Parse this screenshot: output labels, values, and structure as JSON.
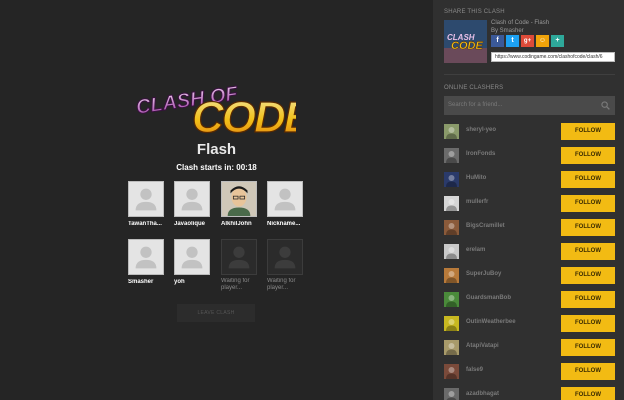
{
  "clash": {
    "logo_line1": "CLASH OF",
    "logo_line2": "CODE",
    "title": "Flash",
    "starts_label": "Clash starts in: 00:18",
    "leave_label": "LEAVE CLASH"
  },
  "players": [
    {
      "name": "TawanTha...",
      "state": "joined",
      "avatar": "default"
    },
    {
      "name": "Javaolique",
      "state": "joined",
      "avatar": "default"
    },
    {
      "name": "AlkhilJohn",
      "state": "joined",
      "avatar": "photo"
    },
    {
      "name": "Nickname...",
      "state": "joined",
      "avatar": "default"
    },
    {
      "name": "Smasher",
      "state": "joined",
      "avatar": "default"
    },
    {
      "name": "yoh",
      "state": "joined",
      "avatar": "default"
    },
    {
      "name": "Waiting for player...",
      "state": "waiting",
      "avatar": "empty"
    },
    {
      "name": "Waiting for player...",
      "state": "waiting",
      "avatar": "empty"
    }
  ],
  "share": {
    "section_title": "SHARE THIS CLASH",
    "clash_name": "Clash of Code - Flash",
    "by_line": "By Smasher",
    "thumb_line1": "CLASH",
    "thumb_line2": "CODE",
    "buttons": [
      {
        "icon": "facebook-icon",
        "glyph": "f",
        "color": "#3b5998"
      },
      {
        "icon": "twitter-icon",
        "glyph": "t",
        "color": "#1da1f2"
      },
      {
        "icon": "googleplus-icon",
        "glyph": "g+",
        "color": "#dd4b39"
      },
      {
        "icon": "vk-icon",
        "glyph": "☺",
        "color": "#f0a30a"
      },
      {
        "icon": "more-icon",
        "glyph": "+",
        "color": "#2ea89a"
      }
    ],
    "url": "https://www.codingame.com/clashofcode/clash/6"
  },
  "online": {
    "section_title": "ONLINE CLASHERS",
    "search_placeholder": "Search for a friend...",
    "follow_label": "FOLLOW",
    "clashers": [
      {
        "name": "sheryl-yeo",
        "avatar_color": "#8a9a6a"
      },
      {
        "name": "IronFonds",
        "avatar_color": "#6b6b6b"
      },
      {
        "name": "HuMito",
        "avatar_color": "#2a3a6a"
      },
      {
        "name": "mullerfr",
        "avatar_color": "#d6d6d6"
      },
      {
        "name": "BigsCramillet",
        "avatar_color": "#8a5a3a"
      },
      {
        "name": "erelam",
        "avatar_color": "#c8c8c8"
      },
      {
        "name": "SuperJuBoy",
        "avatar_color": "#b87a3a"
      },
      {
        "name": "GuardsmanBob",
        "avatar_color": "#4a8a3a"
      },
      {
        "name": "OutinWeatherbee",
        "avatar_color": "#c8b820"
      },
      {
        "name": "AtapiVatapi",
        "avatar_color": "#a89a6a"
      },
      {
        "name": "false9",
        "avatar_color": "#7a4a3a"
      },
      {
        "name": "azadbhagat",
        "avatar_color": "#6a6a6a"
      }
    ]
  }
}
